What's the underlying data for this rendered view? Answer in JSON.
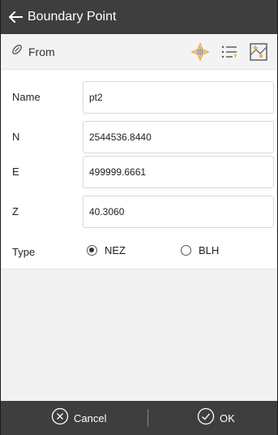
{
  "header": {
    "title": "Boundary Point",
    "back_icon": "arrow-left-icon"
  },
  "toolbar": {
    "from_label": "From",
    "from_icon": "link-icon",
    "icons": [
      "gps-locate-icon",
      "point-list-icon",
      "map-pick-icon"
    ],
    "accent": "#f2a33a"
  },
  "form": {
    "fields": [
      {
        "label": "Name",
        "value": "pt2"
      },
      {
        "label": "N",
        "value": "2544536.8440"
      },
      {
        "label": "E",
        "value": "499999.6661"
      },
      {
        "label": "Z",
        "value": "40.3060"
      }
    ],
    "type": {
      "label": "Type",
      "options": [
        {
          "label": "NEZ",
          "selected": true
        },
        {
          "label": "BLH",
          "selected": false
        }
      ]
    }
  },
  "footer": {
    "cancel_label": "Cancel",
    "ok_label": "OK"
  },
  "colors": {
    "bar": "#3e3e3e",
    "background": "#f1f1f1"
  }
}
